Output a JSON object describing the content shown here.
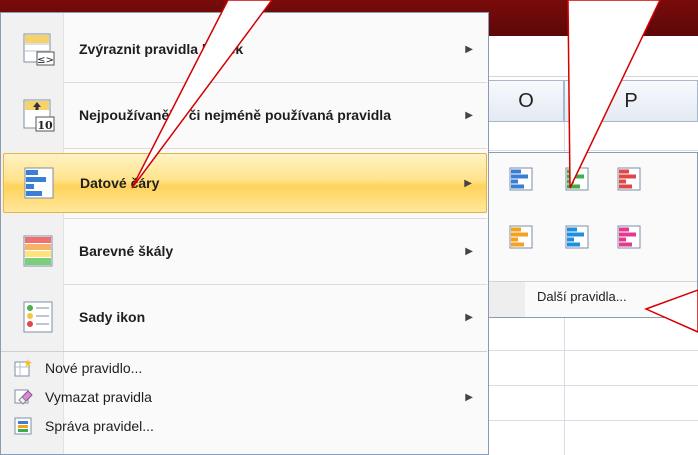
{
  "columns": [
    "O",
    "P"
  ],
  "menu": {
    "items": [
      {
        "label": "Zvýraznit pravidla buněk",
        "icon": "highlight-cell-rules-icon",
        "submenu": true
      },
      {
        "label": "Nejpoužívanější či nejméně používaná pravidla",
        "icon": "top-bottom-rules-icon",
        "submenu": true
      },
      {
        "label": "Datové čáry",
        "icon": "data-bars-icon",
        "submenu": true,
        "highlighted": true
      },
      {
        "label": "Barevné škály",
        "icon": "color-scales-icon",
        "submenu": true
      },
      {
        "label": "Sady ikon",
        "icon": "icon-sets-icon",
        "submenu": true
      }
    ],
    "small_items": [
      {
        "label": "Nové pravidlo...",
        "icon": "new-rule-icon",
        "submenu": false
      },
      {
        "label": "Vymazat pravidla",
        "icon": "clear-rules-icon",
        "submenu": true
      },
      {
        "label": "Správa pravidel...",
        "icon": "manage-rules-icon",
        "submenu": false
      }
    ],
    "top_bottom_badge": "10"
  },
  "submenu": {
    "gallery": [
      {
        "name": "blue-data-bar",
        "color": "#3a7fd5"
      },
      {
        "name": "green-data-bar",
        "color": "#3fae49"
      },
      {
        "name": "red-data-bar",
        "color": "#e04848"
      },
      {
        "name": "orange-data-bar",
        "color": "#f3a11f"
      },
      {
        "name": "light-blue-data-bar",
        "color": "#1f8fe0"
      },
      {
        "name": "purple-data-bar",
        "color": "#e4398e"
      }
    ],
    "more_label": "Další pravidla..."
  },
  "colors": {
    "highlight": "#ffd35c",
    "callout_line": "#d40000",
    "background": "#6f0a0a"
  }
}
